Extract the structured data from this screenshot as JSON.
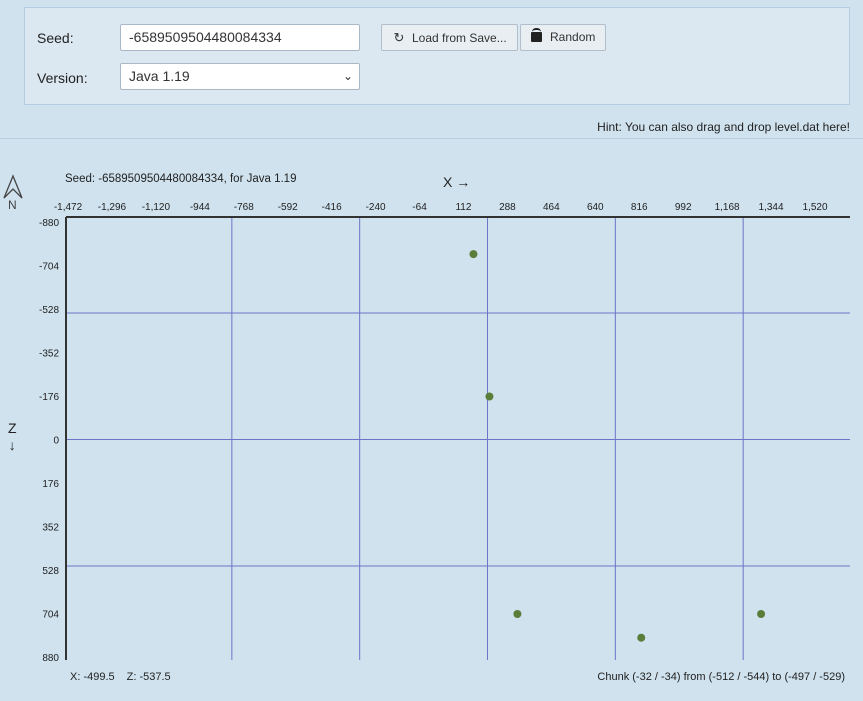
{
  "form": {
    "seed_label": "Seed:",
    "seed_value": "-6589509504480084334",
    "version_label": "Version:",
    "version_value": "Java 1.19",
    "load_button": "Load from Save...",
    "random_button": "Random",
    "hint": "Hint: You can also drag and drop level.dat here!"
  },
  "map": {
    "seed_caption": "Seed: -6589509504480084334, for Java 1.19",
    "x_axis_label": "X →",
    "z_axis_label": "Z",
    "z_axis_arrow": "↓",
    "compass_letter": "N",
    "x_ticks": [
      "-1,472",
      "-1,296",
      "-1,120",
      "-944",
      "-768",
      "-592",
      "-416",
      "-240",
      "-64",
      "112",
      "288",
      "464",
      "640",
      "816",
      "992",
      "1,168",
      "1,344",
      "1,520"
    ],
    "z_ticks": [
      "-880",
      "-704",
      "-528",
      "-352",
      "-176",
      "0",
      "176",
      "352",
      "528",
      "704",
      "880"
    ],
    "points": [
      {
        "x": 152,
        "z": -750
      },
      {
        "x": 216,
        "z": -174
      },
      {
        "x": 328,
        "z": 706
      },
      {
        "x": 824,
        "z": 802
      },
      {
        "x": 1304,
        "z": 706
      }
    ],
    "point_color": "#5a7d3a",
    "grid_color": "#6b75c8"
  },
  "status": {
    "x_coord": "X: -499.5",
    "z_coord": "Z: -537.5",
    "chunk_info": "Chunk (-32 / -34) from (-512 / -544) to (-497 / -529)"
  }
}
